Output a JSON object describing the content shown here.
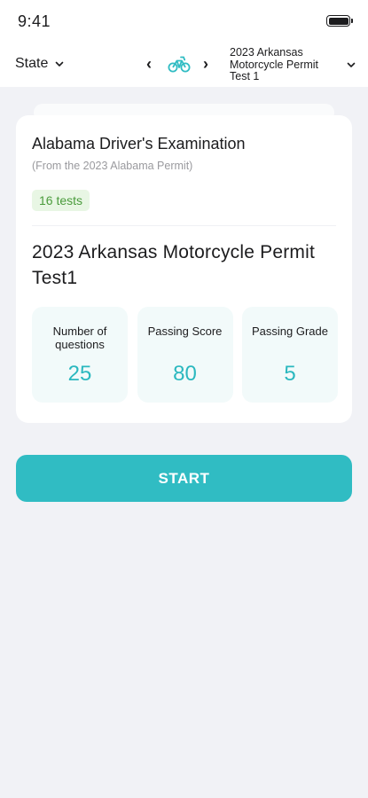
{
  "status_bar": {
    "time": "9:41"
  },
  "nav": {
    "state_label": "State",
    "prev_glyph": "‹",
    "next_glyph": "›",
    "vehicle_icon": "motorcycle-icon",
    "test_select_label": "2023 Arkansas Motorcycle Permit Test 1"
  },
  "exam": {
    "title": "Alabama Driver's Examination",
    "source": "(From the 2023 Alabama Permit)",
    "tests_badge": "16 tests"
  },
  "test": {
    "title": "2023 Arkansas Motorcycle Permit Test1",
    "stats": [
      {
        "label": "Number of questions",
        "value": "25"
      },
      {
        "label": "Passing Score",
        "value": "80"
      },
      {
        "label": "Passing Grade",
        "value": "5"
      }
    ]
  },
  "start_label": "START",
  "colors": {
    "accent": "#30bcc3",
    "accent_text": "#2bb8bf",
    "badge_bg": "#e8f6e4",
    "badge_text": "#4a9b3c",
    "page_bg": "#f1f2f6"
  }
}
